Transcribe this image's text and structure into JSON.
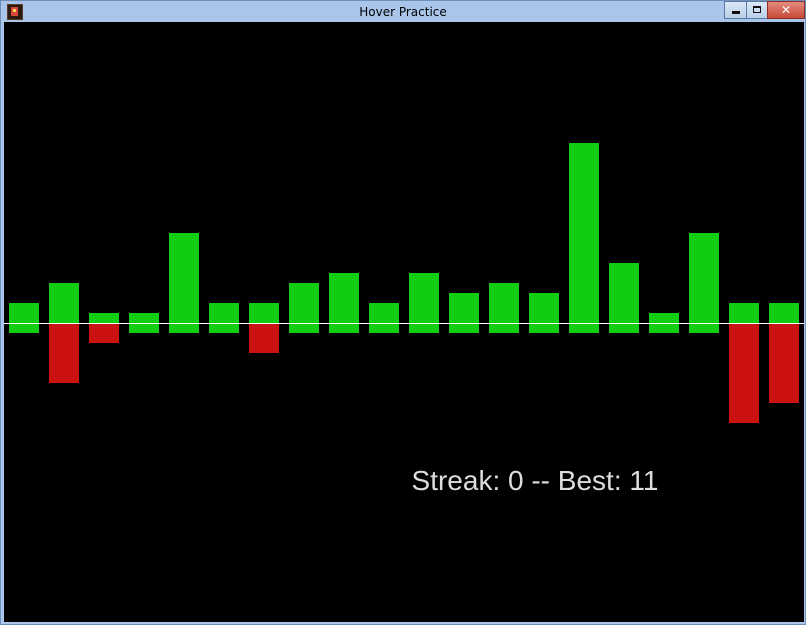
{
  "window": {
    "title": "Hover Practice",
    "close_glyph": "✕",
    "colors": {
      "titlebar": "#a9c6ea",
      "border": "#6d8fb8",
      "close": "#c74a38"
    }
  },
  "game": {
    "background": "#000000",
    "baseline_color": "#ffffff",
    "up_color": "#11cc11",
    "down_color": "#cc1111",
    "bars": [
      {
        "up": 2,
        "down": 1
      },
      {
        "up": 4,
        "down": 6
      },
      {
        "up": 1,
        "down": 2
      },
      {
        "up": 1,
        "down": 1
      },
      {
        "up": 9,
        "down": 1
      },
      {
        "up": 2,
        "down": 1
      },
      {
        "up": 2,
        "down": 3
      },
      {
        "up": 4,
        "down": 1
      },
      {
        "up": 5,
        "down": 1
      },
      {
        "up": 2,
        "down": 1
      },
      {
        "up": 5,
        "down": 1
      },
      {
        "up": 3,
        "down": 1
      },
      {
        "up": 4,
        "down": 1
      },
      {
        "up": 3,
        "down": 1
      },
      {
        "up": 18,
        "down": 1
      },
      {
        "up": 6,
        "down": 1
      },
      {
        "up": 1,
        "down": 1
      },
      {
        "up": 9,
        "down": 1
      },
      {
        "up": 2,
        "down": 10
      },
      {
        "up": 2,
        "down": 8
      }
    ],
    "streak_label": "Streak:",
    "streak_value": "0",
    "separator": "--",
    "best_label": "Best:",
    "best_value": "11"
  }
}
